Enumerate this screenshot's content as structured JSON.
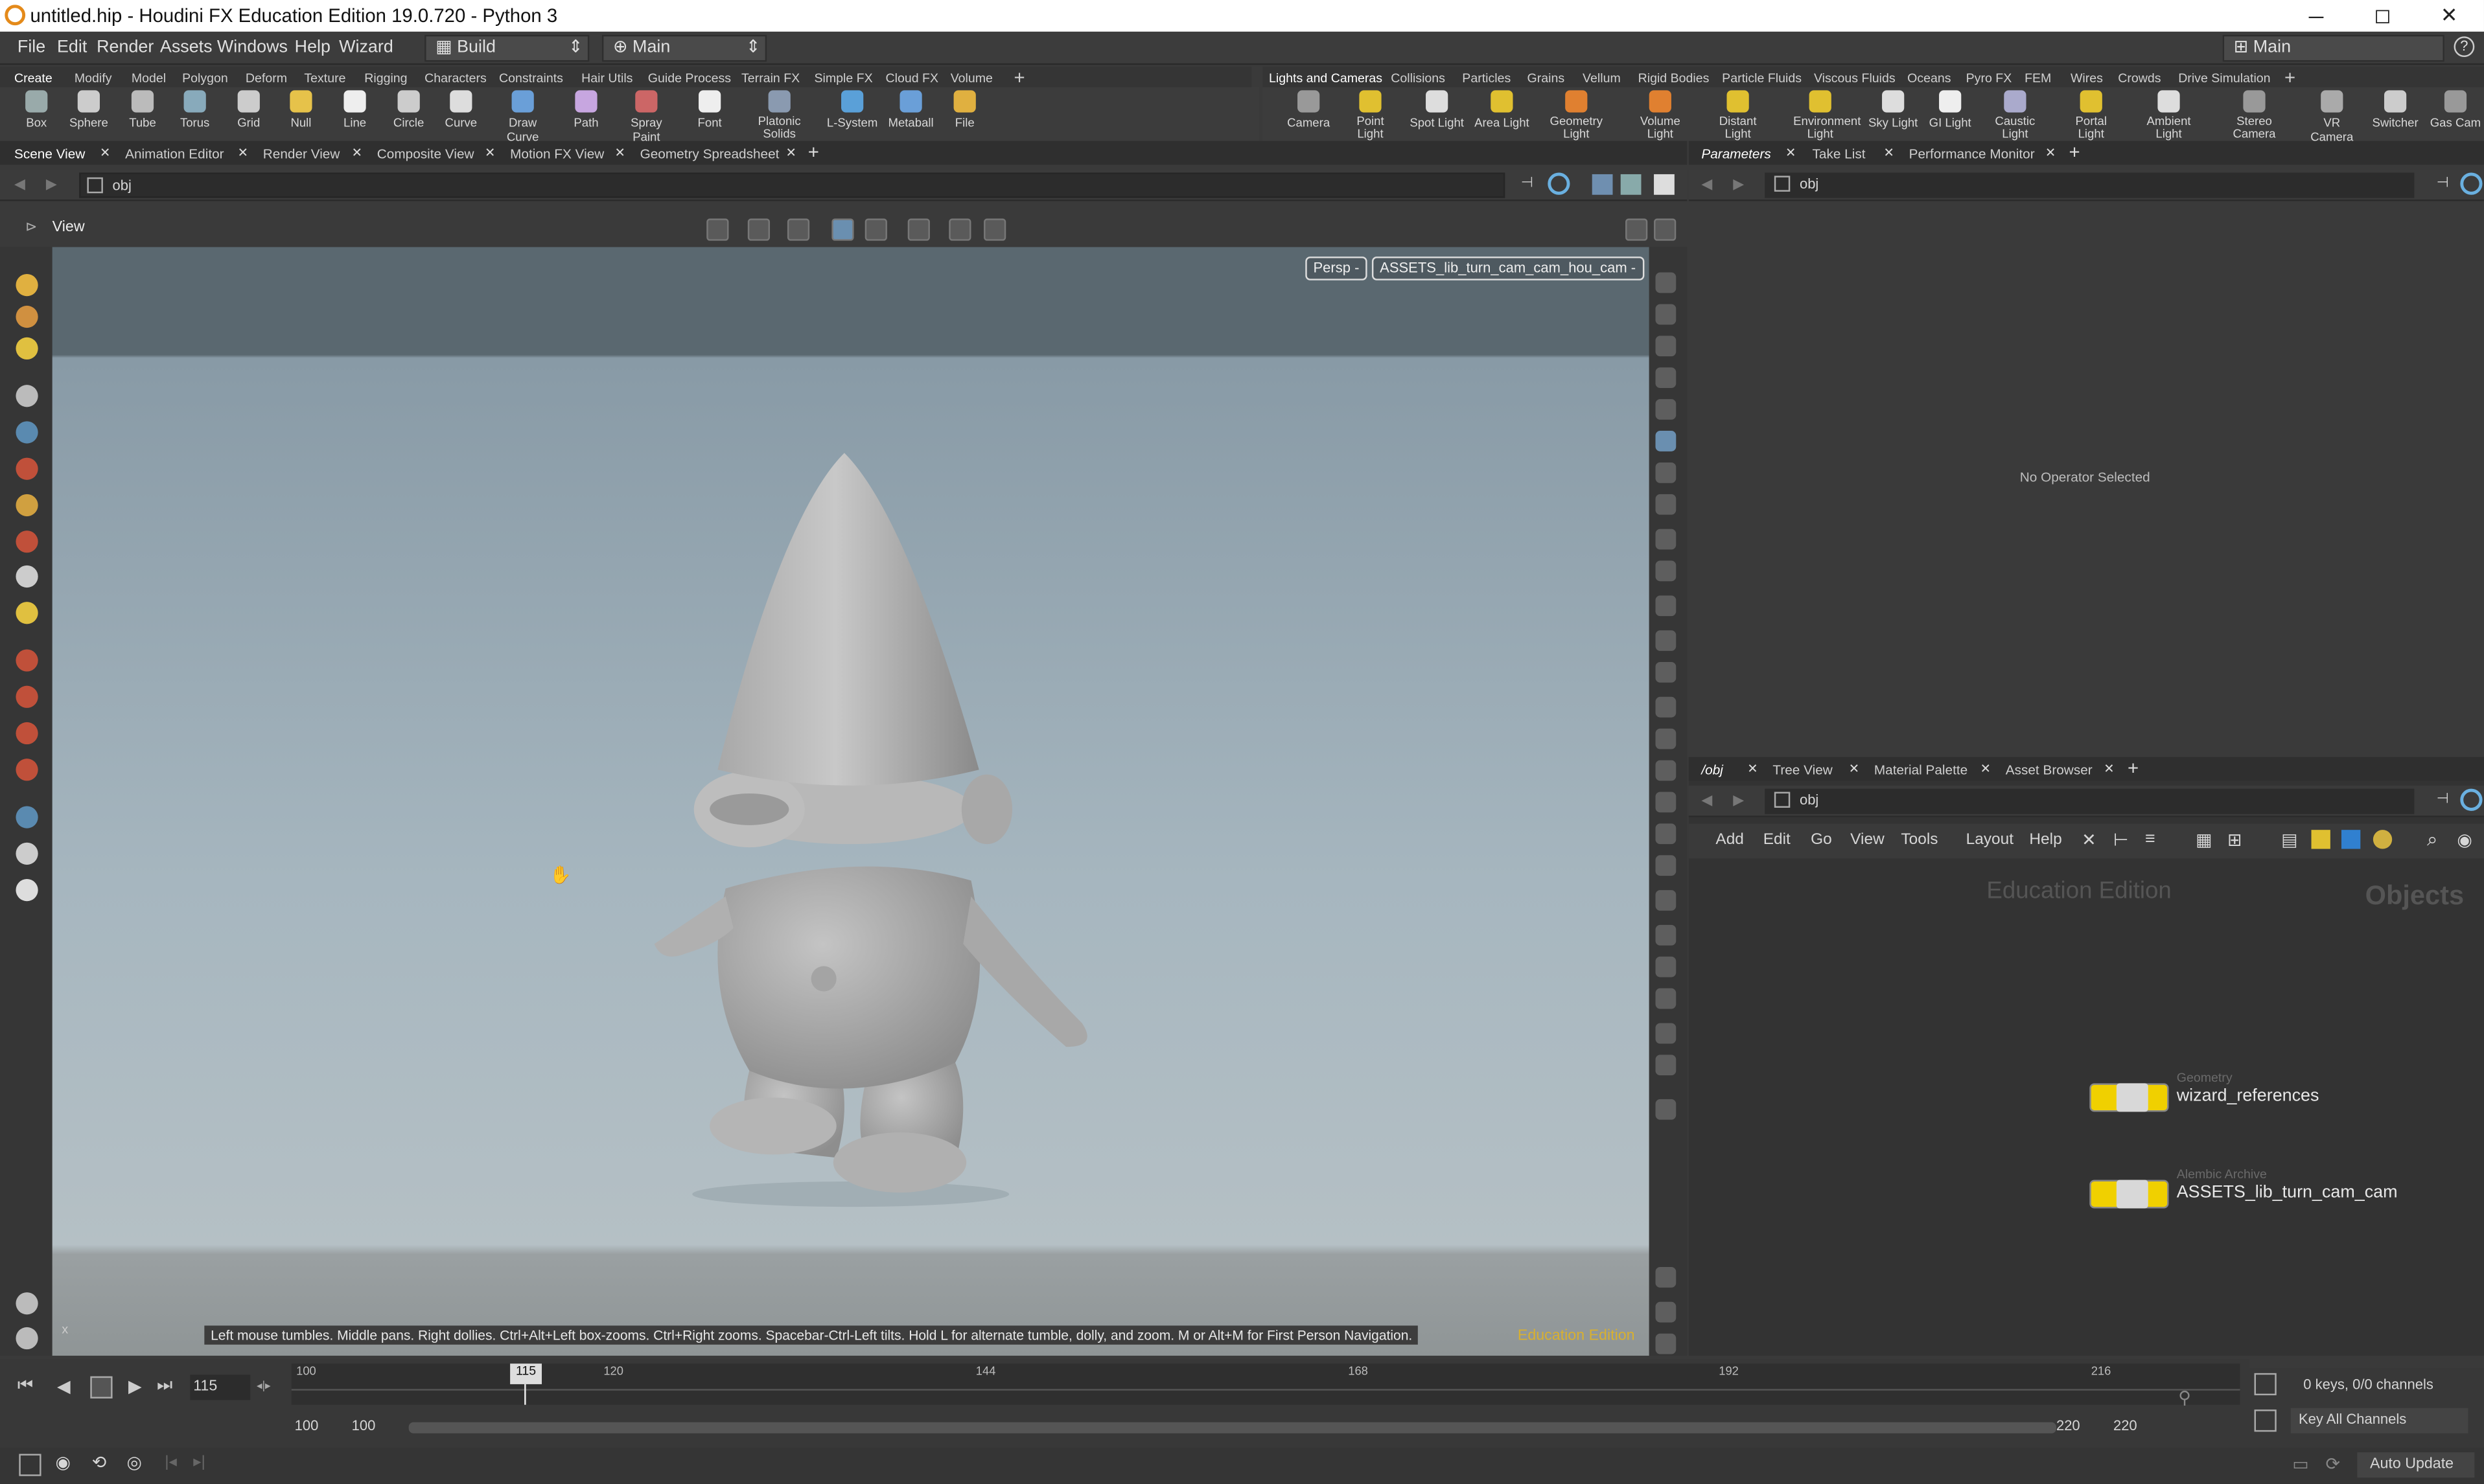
{
  "window": {
    "title": "untitled.hip - Houdini FX Education Edition 19.0.720 - Python 3",
    "minimize": "─",
    "maximize": "◻",
    "close": "✕"
  },
  "menubar": {
    "items": [
      "File",
      "Edit",
      "Render",
      "Assets",
      "Windows",
      "Help",
      "Wizard"
    ],
    "desktop_label": "Build",
    "main_label": "Main",
    "right_desktop_label": "Main",
    "help_icon": "?"
  },
  "shelf_left": {
    "tabs": [
      "Create",
      "Modify",
      "Model",
      "Polygon",
      "Deform",
      "Texture",
      "Rigging",
      "Characters",
      "Constraints",
      "Hair Utils",
      "Guide Process",
      "Terrain FX",
      "Simple FX",
      "Cloud FX",
      "Volume"
    ],
    "tools": [
      "Box",
      "Sphere",
      "Tube",
      "Torus",
      "Grid",
      "Null",
      "Line",
      "Circle",
      "Curve",
      "Draw Curve",
      "Path",
      "Spray Paint",
      "Font",
      "Platonic Solids",
      "L-System",
      "Metaball",
      "File"
    ]
  },
  "shelf_right": {
    "tabs": [
      "Lights and Cameras",
      "Collisions",
      "Particles",
      "Grains",
      "Vellum",
      "Rigid Bodies",
      "Particle Fluids",
      "Viscous Fluids",
      "Oceans",
      "Pyro FX",
      "FEM",
      "Wires",
      "Crowds",
      "Drive Simulation"
    ],
    "tools": [
      "Camera",
      "Point Light",
      "Spot Light",
      "Area Light",
      "Geometry Light",
      "Volume Light",
      "Distant Light",
      "Environment Light",
      "Sky Light",
      "GI Light",
      "Caustic Light",
      "Portal Light",
      "Ambient Light",
      "Stereo Camera",
      "VR Camera",
      "Switcher",
      "Gas Cam"
    ]
  },
  "left_pane": {
    "tabs": [
      "Scene View",
      "Animation Editor",
      "Render View",
      "Composite View",
      "Motion FX View",
      "Geometry Spreadsheet"
    ],
    "path": "obj",
    "view_label": "View"
  },
  "viewport": {
    "persp_label": "Persp -",
    "camera_label": "ASSETS_lib_turn_cam_cam_hou_cam -",
    "hint": "Left mouse tumbles. Middle pans. Right dollies. Ctrl+Alt+Left box-zooms. Ctrl+Right zooms. Spacebar-Ctrl-Left tilts. Hold L for alternate tumble, dolly, and zoom.    M or Alt+M for First Person Navigation.",
    "edition": "Education Edition",
    "axis_label": "x"
  },
  "params_pane": {
    "tabs": [
      "Parameters",
      "Take List",
      "Performance Monitor"
    ],
    "path": "obj",
    "empty_message": "No Operator Selected"
  },
  "network_pane": {
    "tabs": [
      "/obj",
      "Tree View",
      "Material Palette",
      "Asset Browser"
    ],
    "path": "obj",
    "menu": [
      "Add",
      "Edit",
      "Go",
      "View",
      "Tools",
      "Layout",
      "Help"
    ],
    "watermark": "Education Edition",
    "context_label": "Objects",
    "nodes": [
      {
        "type": "Geometry",
        "name": "wizard_references"
      },
      {
        "type": "Alembic Archive",
        "name": "ASSETS_lib_turn_cam_cam"
      }
    ]
  },
  "timeline": {
    "current_frame": "115",
    "ticks": [
      "100",
      "120",
      "144",
      "168",
      "192",
      "216"
    ],
    "frame_marker": "115",
    "range_start": "100",
    "range_start2": "100",
    "range_end": "220",
    "range_end2": "220",
    "keys_info": "0 keys, 0/0 channels",
    "key_all": "Key All Channels"
  },
  "status": {
    "auto_update": "Auto Update"
  },
  "colors": {
    "viewport_top": "#5a6870",
    "viewport_mid": "#a6b6bf",
    "node_yellow": "#f0d000",
    "accent_orange": "#e48a1a",
    "edition_gold": "#d8b030"
  }
}
